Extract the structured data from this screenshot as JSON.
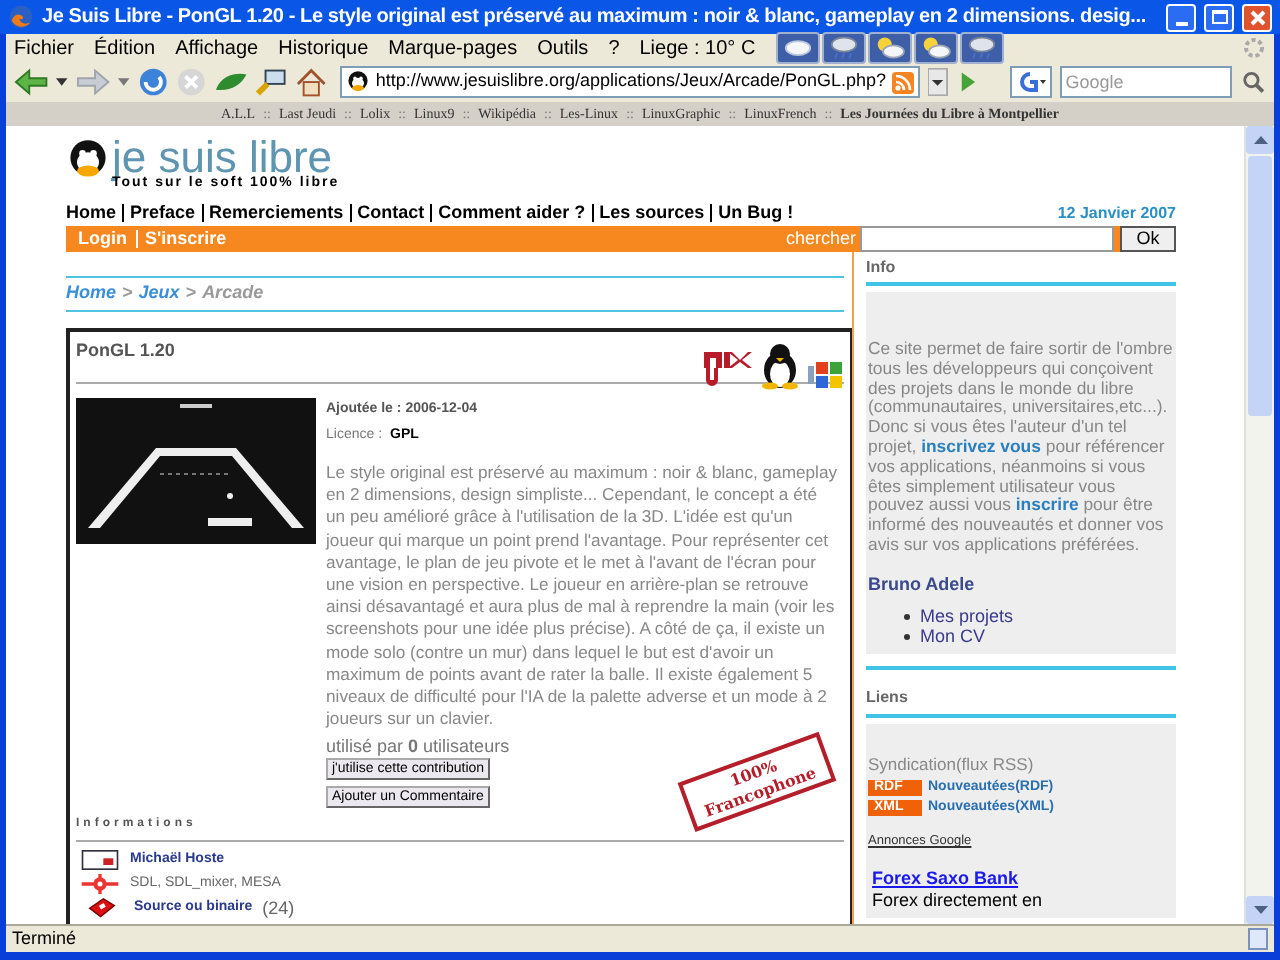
{
  "window": {
    "title": "Je Suis Libre - PonGL 1.20 - Le style original est préservé au maximum : noir & blanc, gameplay en 2 dimensions. desig..."
  },
  "menu": [
    "Fichier",
    "Édition",
    "Affichage",
    "Historique",
    "Marque-pages",
    "Outils",
    "?"
  ],
  "weather": {
    "label": "Liege : 10° C"
  },
  "toolbar": {
    "url": "http://www.jesuislibre.org/applications/Jeux/Arcade/PonGL.php?",
    "search_placeholder": "Google"
  },
  "bookmarks": [
    "A.L.L",
    "Last Jeudi",
    "Lolix",
    "Linux9",
    "Wikipédia",
    "Les-Linux",
    "LinuxGraphic",
    "LinuxFrench",
    "Les Journées du Libre à Montpellier"
  ],
  "bookmark_separator": "::",
  "site": {
    "logo": "je suis libre",
    "tagline": "Tout sur le soft 100% libre",
    "nav": [
      "Home",
      "Preface",
      "Remerciements",
      "Contact",
      "Comment aider ?",
      "Les sources",
      "Un Bug !"
    ],
    "date": "12 Janvier 2007",
    "account": [
      "Login",
      "S'inscrire"
    ],
    "search_label": "chercher",
    "search_button": "Ok"
  },
  "breadcrumb": {
    "items": [
      "Home",
      "Jeux",
      "Arcade"
    ],
    "separator": ">"
  },
  "article": {
    "title": "PonGL 1.20",
    "added_label": "Ajoutée le :",
    "added_date": "2006-12-04",
    "licence_label": "Licence :",
    "licence": "GPL",
    "description": "Le style original est préservé au maximum : noir & blanc, gameplay en 2 dimensions, design simpliste... Cependant, le concept a été un peu amélioré grâce à l'utilisation de la 3D. L'idée est qu'un joueur qui marque un point prend l'avantage. Pour représenter cet avantage, le plan de jeu pivote et le met à l'avant de l'écran pour une vision en perspective. Le joueur en arrière-plan se retrouve ainsi désavantagé et aura plus de mal à reprendre la main (voir les screenshots pour une idée plus précise). A côté de ça, il existe un mode solo (contre un mur) dans lequel le but est d'avoir un maximum de points avant de rater la balle. Il existe également 5 niveaux de difficulté pour l'IA de la palette adverse et un mode à 2 joueurs sur un clavier.",
    "usage": "utilisé par **0** utilisateurs",
    "buttons": [
      "j'utilise cette contribution",
      "Ajouter un Commentaire"
    ],
    "stamp": [
      "100%",
      "Francophone"
    ],
    "info_heading": "Informations",
    "info": [
      {
        "link": true,
        "text": "Michaël Hoste"
      },
      {
        "link": false,
        "text": "SDL, SDL_mixer, MESA"
      },
      {
        "link": true,
        "text": "Source ou binaire",
        "count": "(24)"
      }
    ]
  },
  "sidebar": {
    "info_title": "Info",
    "info_text": [
      {
        "text": "Ce site permet de faire sortir de l'ombre tous les développeurs qui conçoivent des projets dans le monde du libre (communautaires, universitaires,etc...). Donc si vous êtes l'auteur d'un tel projet, ",
        "link": false
      },
      {
        "text": "inscrivez vous",
        "link": true
      },
      {
        "text": " pour référencer vos applications, néanmoins si vous êtes simplement utilisateur vous pouvez aussi vous ",
        "link": false
      },
      {
        "text": "inscrire",
        "link": true
      },
      {
        "text": " pour être informé des nouveautés et donner vos avis sur vos applications préférées.",
        "link": false
      }
    ],
    "author": "Bruno Adele",
    "author_links": [
      "Mes projets",
      "Mon CV"
    ],
    "links_title": "Liens",
    "syndication": "Syndication(flux RSS)",
    "feeds": [
      {
        "badge": "RDF",
        "label": "Nouveautées(RDF)"
      },
      {
        "badge": "XML",
        "label": "Nouveautées(XML)"
      }
    ],
    "ads_label": "Annonces Google",
    "ad_title": "Forex Saxo Bank",
    "ad_text": "Forex directement en"
  },
  "status_bar": {
    "text": "Terminé"
  }
}
